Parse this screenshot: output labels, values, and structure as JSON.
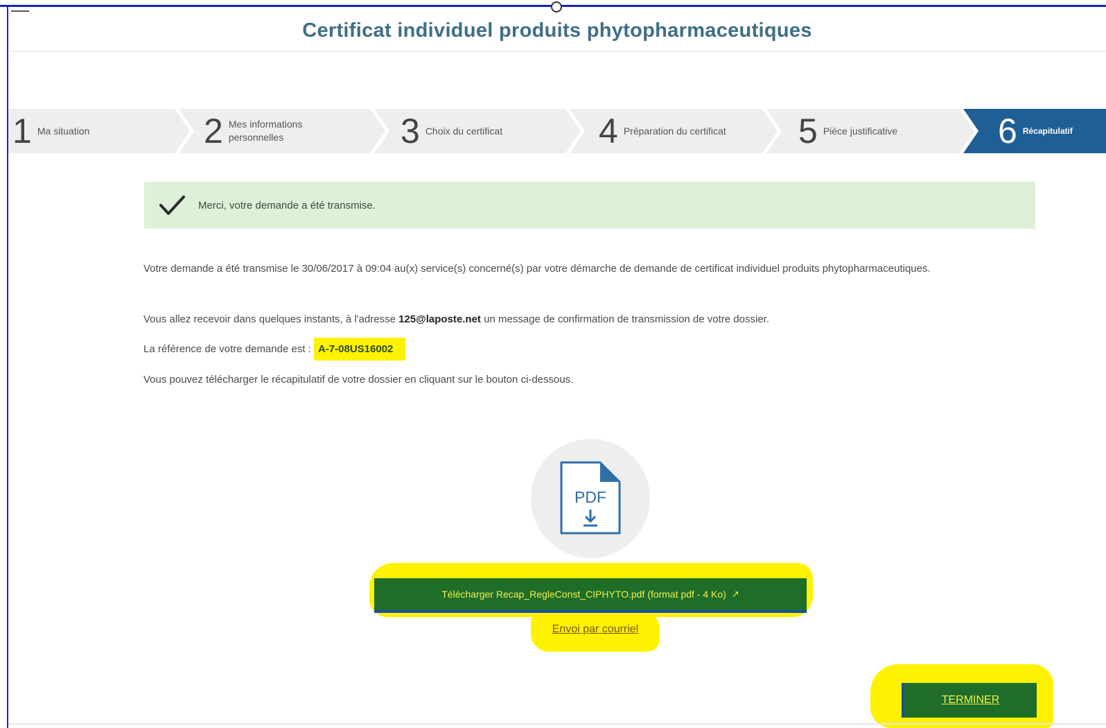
{
  "header": {
    "title": "Certificat individuel produits phytopharmaceutiques"
  },
  "steps": [
    {
      "number": "1",
      "label": "Ma situation"
    },
    {
      "number": "2",
      "label": "Mes informations personnelles"
    },
    {
      "number": "3",
      "label": "Choix du certificat"
    },
    {
      "number": "4",
      "label": "Préparation du certificat"
    },
    {
      "number": "5",
      "label": "Pièce justificative"
    },
    {
      "number": "6",
      "label": "Récapitulatif"
    }
  ],
  "active_step": 6,
  "alert": {
    "message": "Merci, votre demande a été transmise."
  },
  "body": {
    "p1": "Votre demande a été transmise le 30/06/2017 à 09:04 au(x) service(s) concerné(s) par votre démarche de demande de certificat individuel produits phytopharmaceutiques.",
    "p2_before": "Vous allez recevoir dans quelques instants, à l'adresse ",
    "email": "125@laposte.net",
    "p2_after": " un message de confirmation de transmission de votre dossier.",
    "p3_before": "La référence de votre demande est : ",
    "reference": "A-7-08US16002",
    "p4": "Vous pouvez télécharger le récapitulatif de votre dossier en cliquant sur le bouton ci-dessous."
  },
  "pdf_icon": {
    "text": "PDF"
  },
  "actions": {
    "download_label": "Télécharger Recap_RegleConst_CIPHYTO.pdf (format pdf - 4 Ko)",
    "email_label": "Envoi par courriel",
    "finish_label": "TERMINER"
  },
  "colors": {
    "title": "#3f6e86",
    "active_step": "#1f5f96",
    "step_bg": "#eeeeee",
    "alert_bg": "#dff0d8",
    "button_bg": "#1e6e2a",
    "highlight": "#fff200"
  }
}
